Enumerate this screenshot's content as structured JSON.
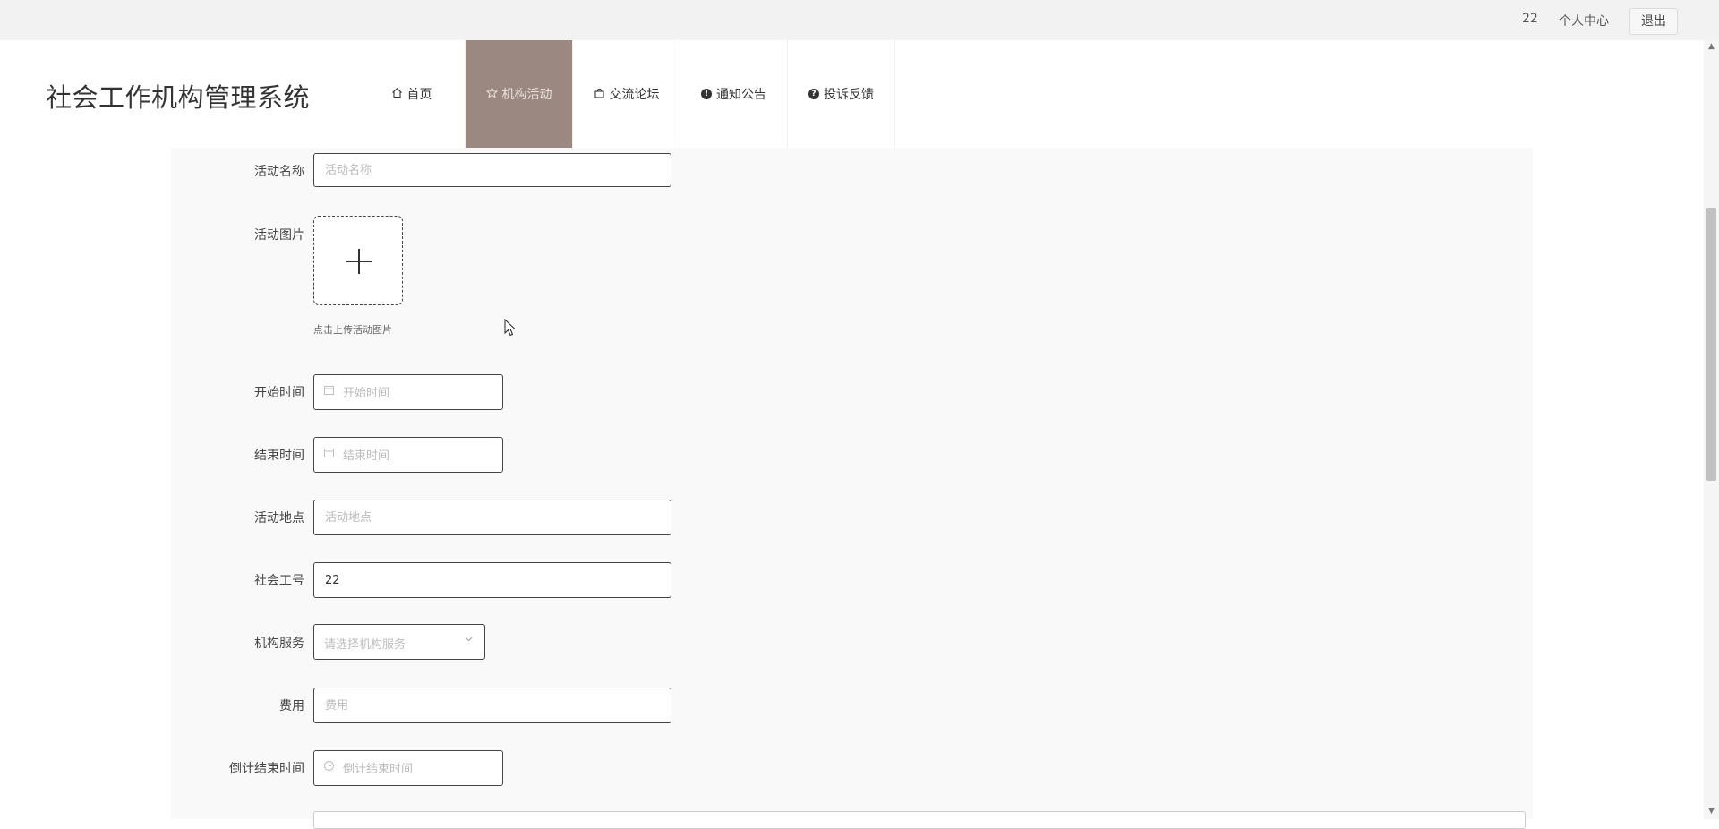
{
  "topbar": {
    "username": "22",
    "personal_center": "个人中心",
    "logout": "退出"
  },
  "site_title": "社会工作机构管理系统",
  "nav": [
    {
      "label": "首页",
      "icon": "home-icon",
      "active": false
    },
    {
      "label": "机构活动",
      "icon": "star-icon",
      "active": true
    },
    {
      "label": "交流论坛",
      "icon": "bag-icon",
      "active": false
    },
    {
      "label": "通知公告",
      "icon": "exclamation-icon",
      "active": false
    },
    {
      "label": "投诉反馈",
      "icon": "question-icon",
      "active": false
    }
  ],
  "form": {
    "activity_name": {
      "label": "活动名称",
      "placeholder": "活动名称"
    },
    "activity_image": {
      "label": "活动图片",
      "tip": "点击上传活动图片"
    },
    "start_time": {
      "label": "开始时间",
      "placeholder": "开始时间"
    },
    "end_time": {
      "label": "结束时间",
      "placeholder": "结束时间"
    },
    "location": {
      "label": "活动地点",
      "placeholder": "活动地点"
    },
    "social_worker_id": {
      "label": "社会工号",
      "value": "22"
    },
    "service": {
      "label": "机构服务",
      "placeholder": "请选择机构服务"
    },
    "fee": {
      "label": "费用",
      "placeholder": "费用"
    },
    "countdown_end": {
      "label": "倒计结束时间",
      "placeholder": "倒计结束时间"
    }
  },
  "colors": {
    "active_nav_bg": "#9b8880",
    "panel_bg": "#f9f9f9",
    "topbar_bg": "#f2f2f2"
  }
}
